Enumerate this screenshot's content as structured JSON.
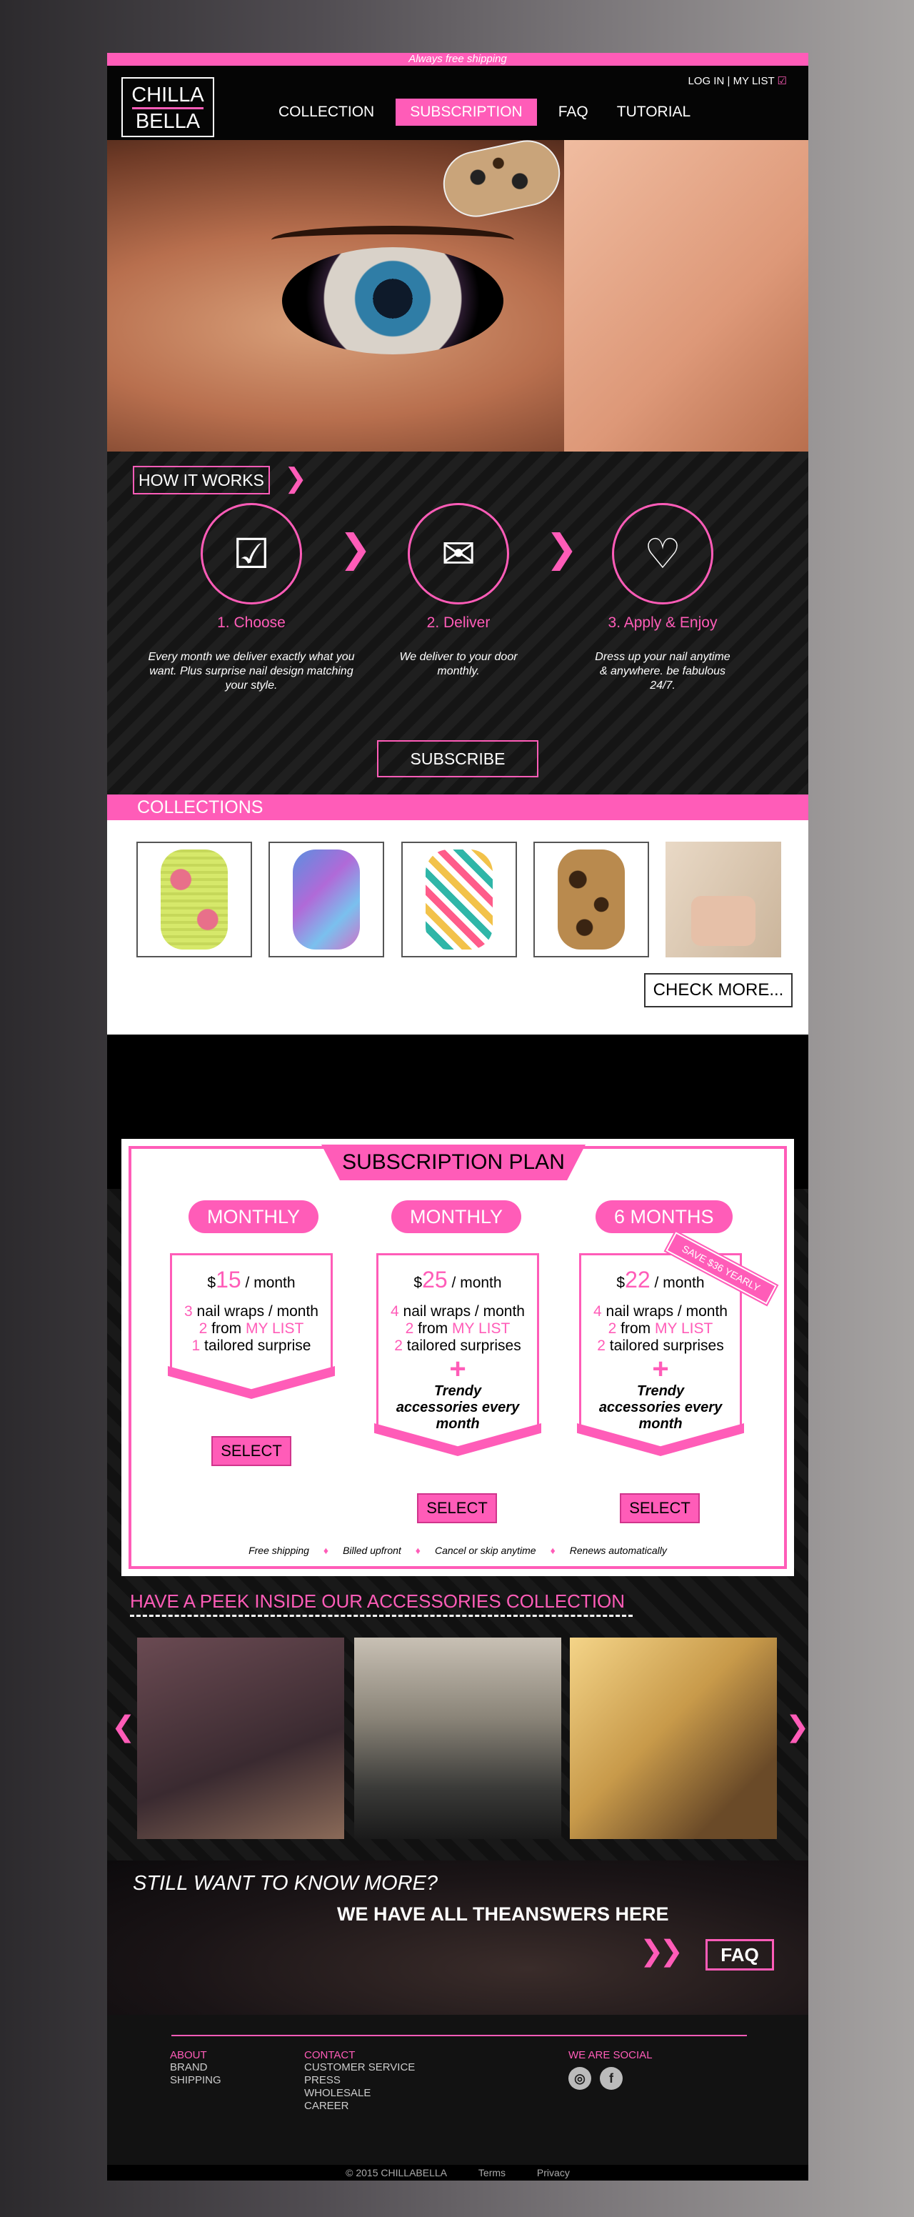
{
  "topbar": {
    "shipping_text": "Always free shipping"
  },
  "header": {
    "logo_line1": "CHILLA",
    "logo_line2": "BELLA",
    "login": "LOG IN",
    "separator": "|",
    "mylist": "MY LIST",
    "nav": [
      "COLLECTION",
      "SUBSCRIPTION",
      "FAQ",
      "TUTORIAL"
    ]
  },
  "how_it_works": {
    "title": "HOW IT WORKS",
    "subscribe": "SUBSCRIBE",
    "steps": [
      {
        "title": "1. Choose",
        "desc": "Every month we deliver exactly what you want. Plus surprise nail design matching your style."
      },
      {
        "title": "2. Deliver",
        "desc": "We deliver to your door monthly."
      },
      {
        "title": "3. Apply & Enjoy",
        "desc": "Dress up your nail anytime & anywhere. be fabulous 24/7."
      }
    ]
  },
  "collections": {
    "title": "COLLECTIONS",
    "check_more": "CHECK MORE..."
  },
  "subscription": {
    "title": "SUBSCRIPTION PLAN",
    "save_badge": "SAVE $36 YEARLY",
    "plans": [
      {
        "name": "MONTHLY",
        "currency": "$",
        "price": "15",
        "per": " / month",
        "wraps_n": "3",
        "wraps": " nail wraps / month",
        "list_n": "2",
        "list_from": " from ",
        "list": "MY LIST",
        "surprise_n": "1",
        "surprise": " tailored surprise",
        "select": "SELECT"
      },
      {
        "name": "MONTHLY",
        "currency": "$",
        "price": "25",
        "per": " / month",
        "wraps_n": "4",
        "wraps": " nail wraps / month",
        "list_n": "2",
        "list_from": " from ",
        "list": "MY LIST",
        "surprise_n": "2",
        "surprise": " tailored surprises",
        "plus": "+",
        "trendy": "Trendy accessories every month",
        "select": "SELECT"
      },
      {
        "name": "6 MONTHS",
        "currency": "$",
        "price": "22",
        "per": " / month",
        "wraps_n": "4",
        "wraps": " nail wraps / month",
        "list_n": "2",
        "list_from": " from ",
        "list": "MY LIST",
        "surprise_n": "2",
        "surprise": " tailored surprises",
        "plus": "+",
        "trendy": "Trendy accessories every month",
        "select": "SELECT"
      }
    ],
    "features": [
      "Free shipping",
      "Billed upfront",
      "Cancel or skip anytime",
      "Renews automatically"
    ]
  },
  "peek": {
    "title": "HAVE A PEEK INSIDE OUR ACCESSORIES COLLECTION"
  },
  "more": {
    "still": "STILL WANT TO KNOW MORE?",
    "answers": "WE HAVE ALL THEANSWERS HERE",
    "faq": "FAQ"
  },
  "footer": {
    "about_head": "ABOUT",
    "about": [
      "BRAND",
      "SHIPPING"
    ],
    "contact_head": "CONTACT",
    "contact": [
      "CUSTOMER SERVICE",
      "PRESS",
      "WHOLESALE",
      "CAREER"
    ],
    "social_head": "WE ARE SOCIAL",
    "copyright": "© 2015 CHILLABELLA",
    "terms": "Terms",
    "privacy": "Privacy"
  },
  "colors": {
    "accent": "#ff5cb8",
    "dark": "#000000"
  }
}
